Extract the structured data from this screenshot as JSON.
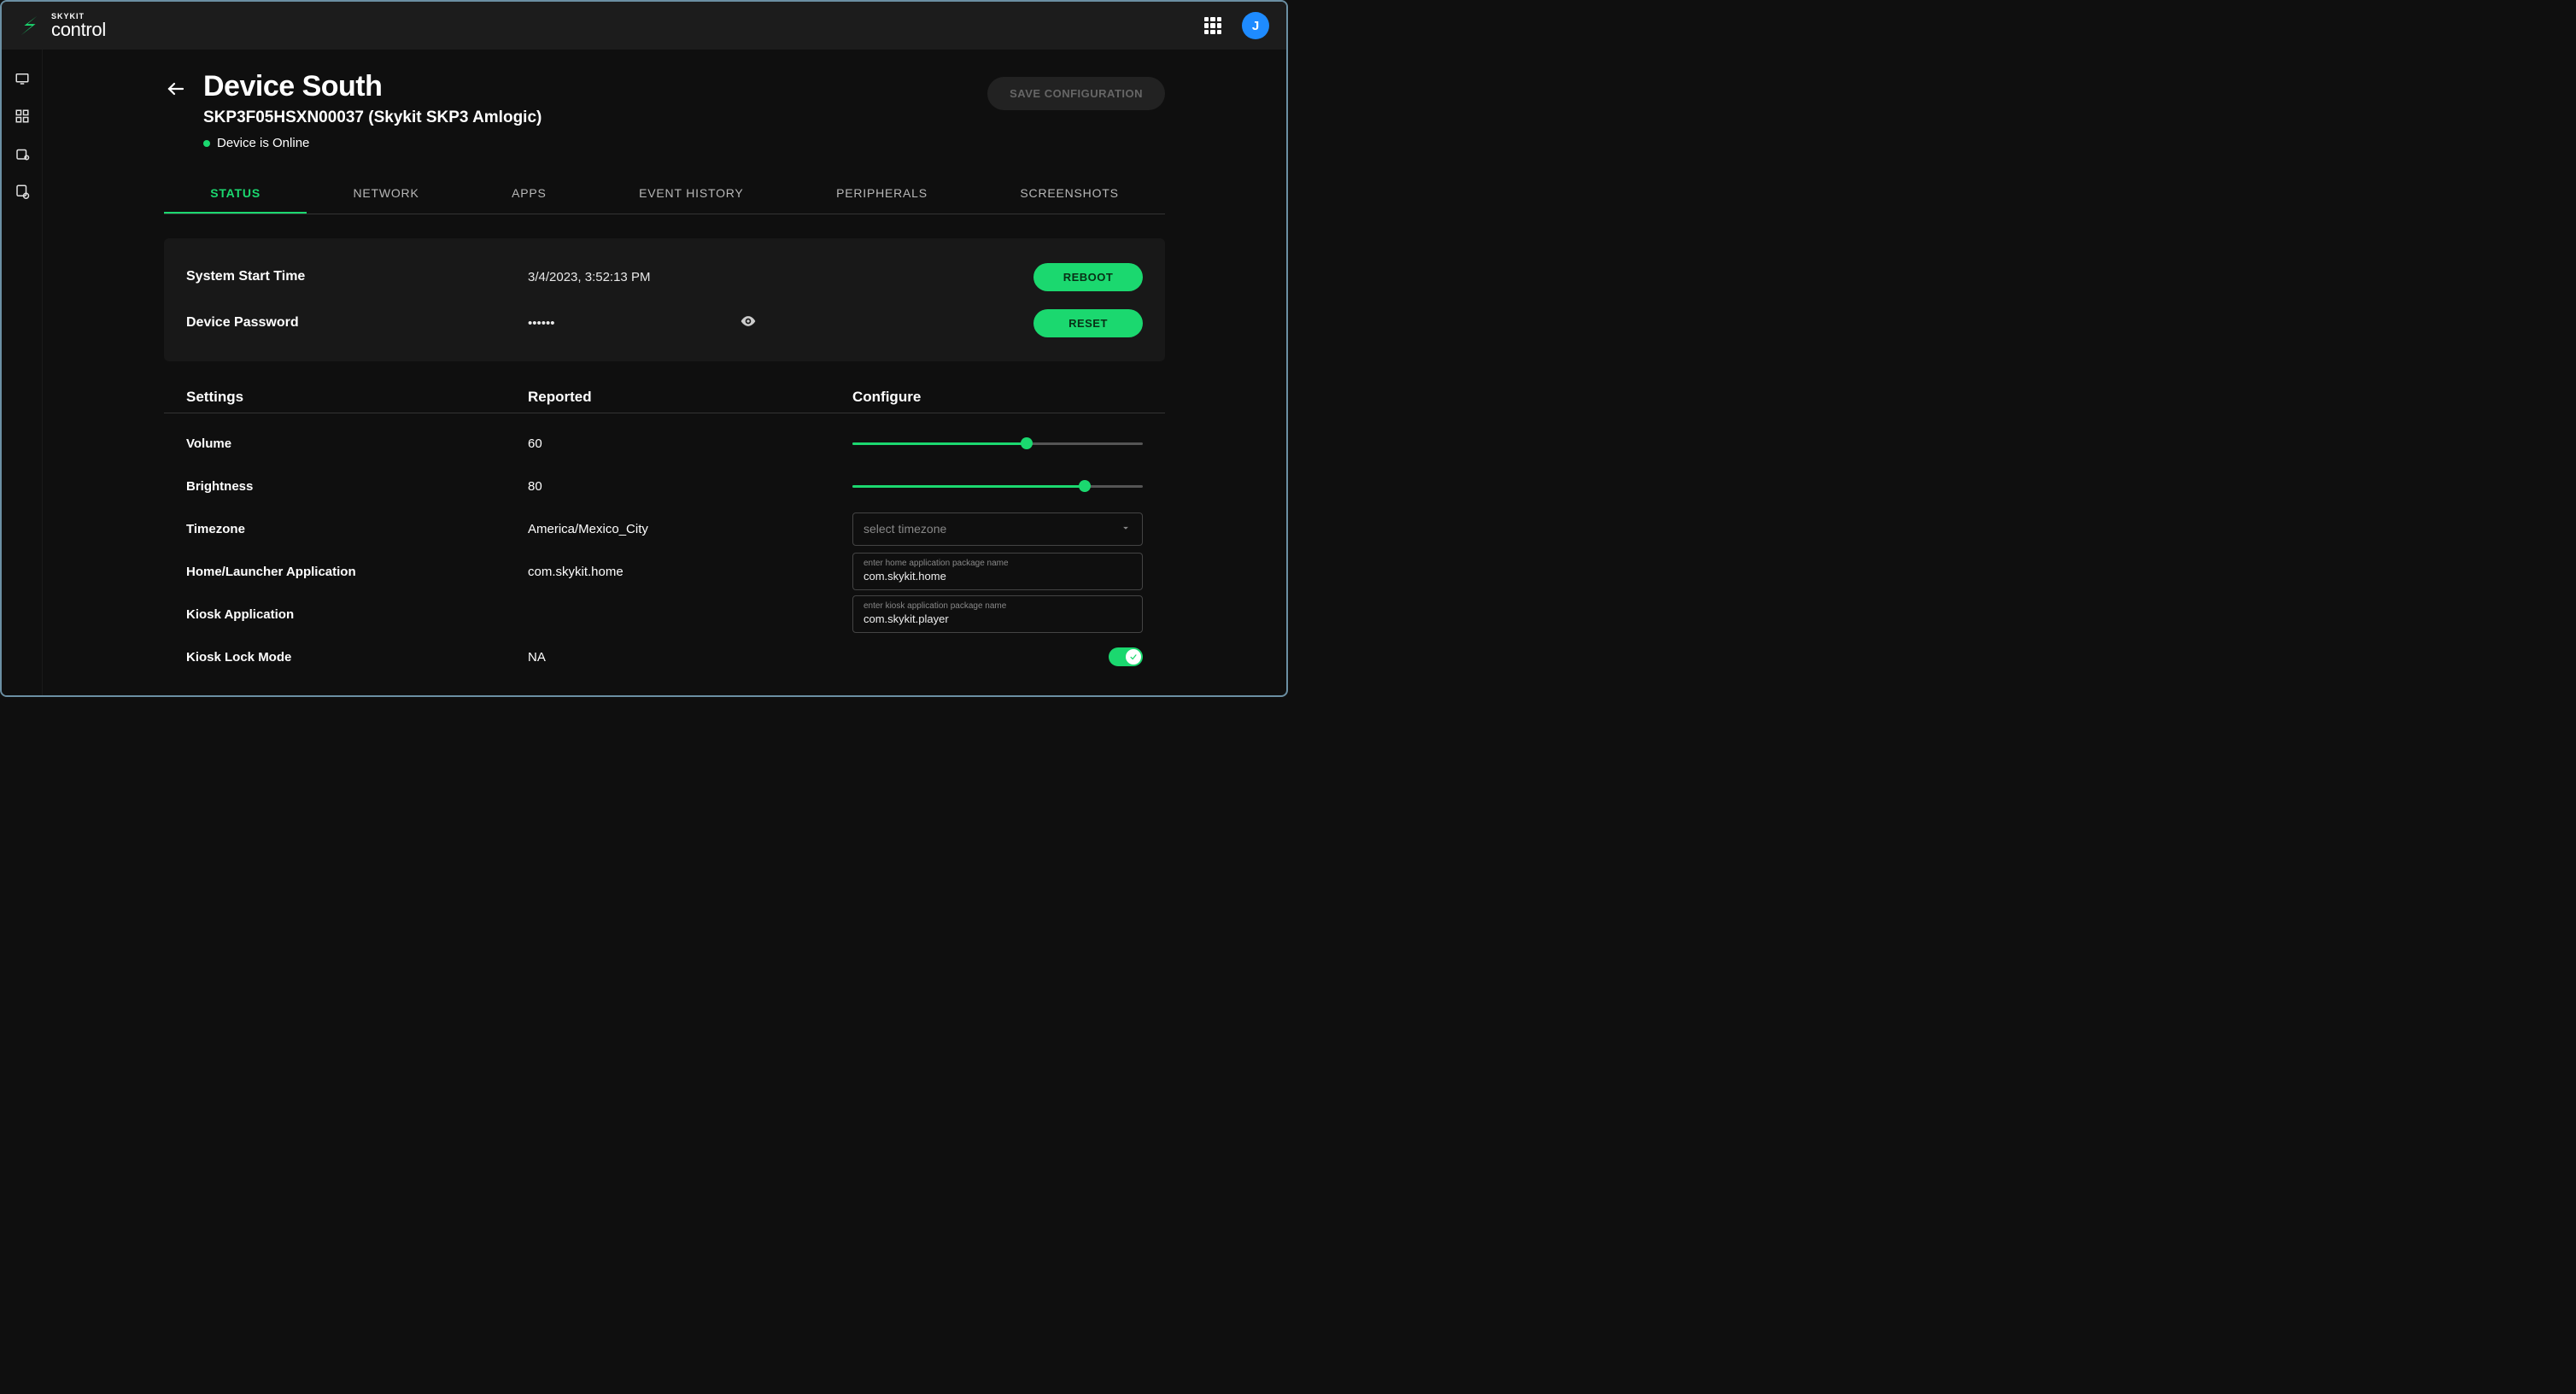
{
  "brand": {
    "company": "SKYKIT",
    "product": "control"
  },
  "user": {
    "initial": "J"
  },
  "deviceHeader": {
    "title": "Device South",
    "subtitle": "SKP3F05HSXN00037 (Skykit SKP3 Amlogic)",
    "statusText": "Device is Online",
    "saveLabel": "SAVE CONFIGURATION"
  },
  "tabs": {
    "status": "STATUS",
    "network": "NETWORK",
    "apps": "APPS",
    "eventHistory": "EVENT HISTORY",
    "peripherals": "PERIPHERALS",
    "screenshots": "SCREENSHOTS",
    "active": "status"
  },
  "statusPanel": {
    "systemStartLabel": "System Start Time",
    "systemStartValue": "3/4/2023, 3:52:13 PM",
    "rebootLabel": "REBOOT",
    "passwordLabel": "Device Password",
    "passwordMasked": "••••••",
    "resetLabel": "RESET"
  },
  "settingsHead": {
    "settings": "Settings",
    "reported": "Reported",
    "configure": "Configure"
  },
  "settings": {
    "volume": {
      "label": "Volume",
      "reported": "60",
      "slider": 60
    },
    "brightness": {
      "label": "Brightness",
      "reported": "80",
      "slider": 80
    },
    "timezone": {
      "label": "Timezone",
      "reported": "America/Mexico_City",
      "placeholder": "select timezone"
    },
    "homeApp": {
      "label": "Home/Launcher Application",
      "reported": "com.skykit.home",
      "hint": "enter home application package name",
      "value": "com.skykit.home"
    },
    "kioskApp": {
      "label": "Kiosk Application",
      "reported": "",
      "hint": "enter kiosk application package name",
      "value": "com.skykit.player"
    },
    "kioskLock": {
      "label": "Kiosk Lock Mode",
      "reported": "NA",
      "toggle": true
    }
  }
}
